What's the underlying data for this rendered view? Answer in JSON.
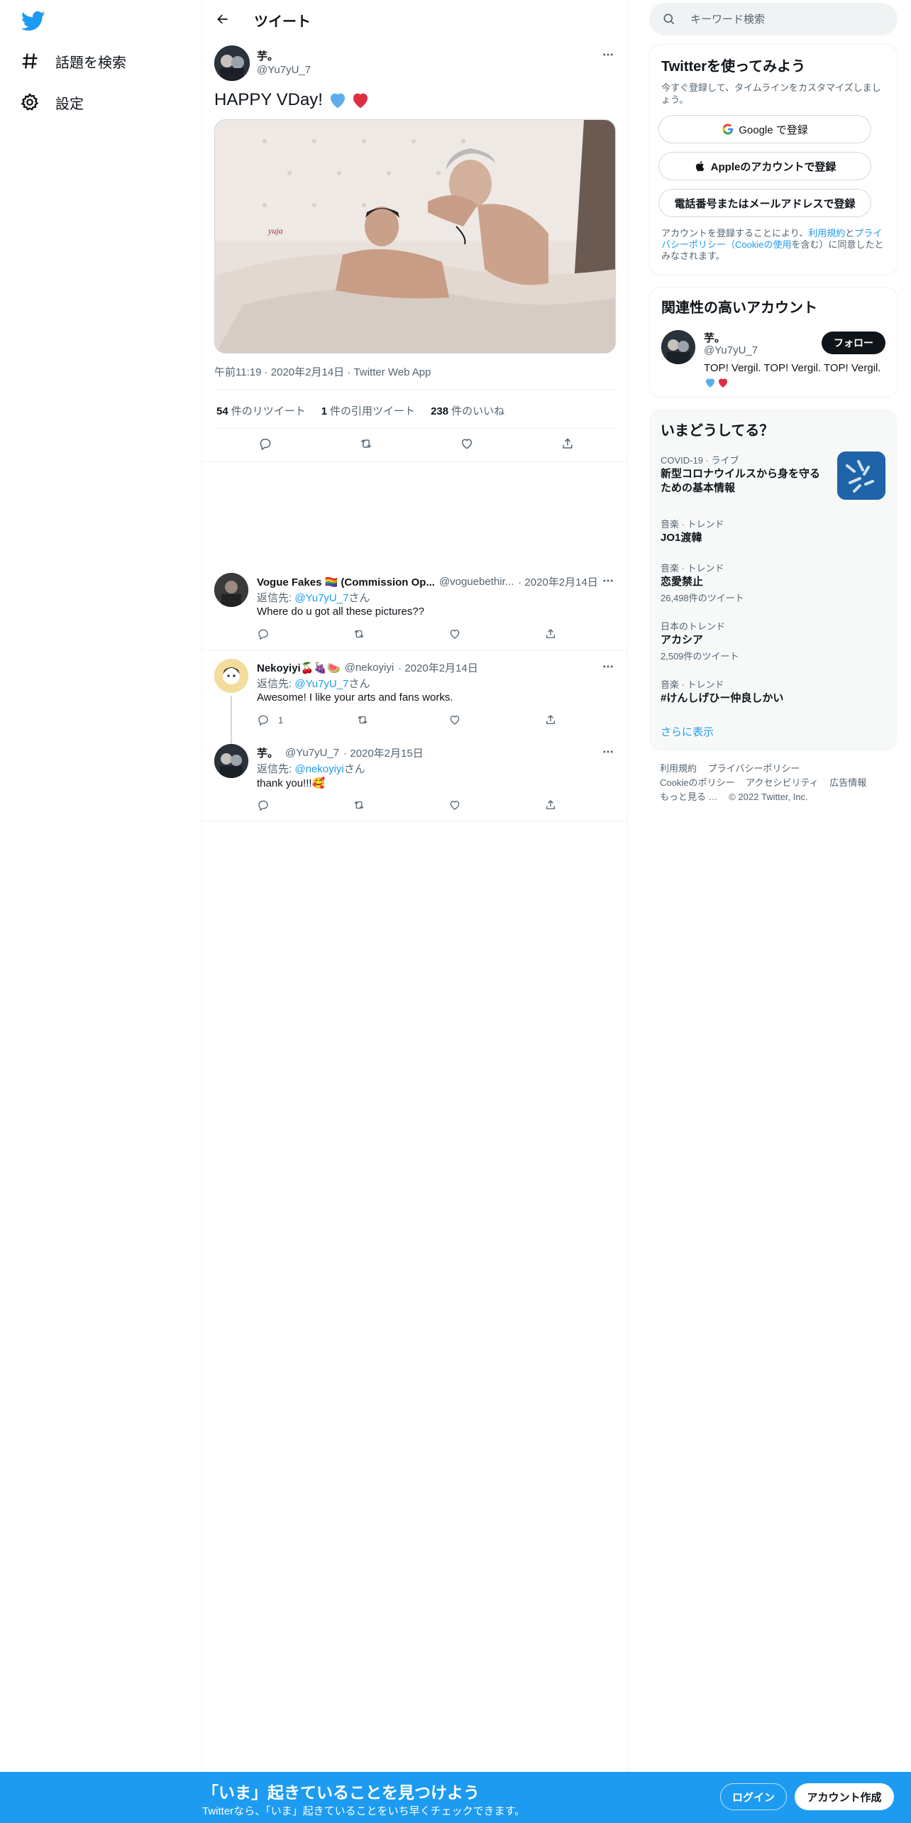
{
  "sidebar": {
    "logo_icon": "twitter-bird-icon",
    "items": [
      {
        "label": "話題を検索",
        "icon": "hashtag-icon"
      },
      {
        "label": "設定",
        "icon": "gear-icon"
      }
    ]
  },
  "header": {
    "title": "ツイート",
    "back_icon": "arrow-left-icon"
  },
  "tweet": {
    "author_name": "芋。",
    "author_handle": "@Yu7yU_7",
    "text": "HAPPY VDay!",
    "emojis": [
      "blue-heart",
      "red-heart"
    ],
    "time": "午前11:19",
    "date": "2020年2月14日",
    "source": "Twitter Web App",
    "dot": "·",
    "stats": {
      "retweets": "54",
      "retweets_label": "件のリツイート",
      "quotes": "1",
      "quotes_label": "件の引用ツイート",
      "likes": "238",
      "likes_label": "件のいいね"
    }
  },
  "replies": [
    {
      "name": "Vogue Fakes 🏳️‍🌈 (Commission Op...",
      "handle": "@voguebethir...",
      "date": "· 2020年2月14日",
      "reply_to_prefix": "返信先: ",
      "reply_to": "@Yu7yU_7",
      "reply_to_suffix": "さん",
      "text": "Where do u got all these pictures??",
      "reply_count": ""
    },
    {
      "name": "Nekoyiyi🍒🍇🍉",
      "handle": "@nekoyiyi",
      "date": "· 2020年2月14日",
      "reply_to_prefix": "返信先: ",
      "reply_to": "@Yu7yU_7",
      "reply_to_suffix": "さん",
      "text": "Awesome! I like your arts and fans works.",
      "reply_count": "1"
    },
    {
      "name": "芋。",
      "handle": "@Yu7yU_7",
      "date": "· 2020年2月15日",
      "reply_to_prefix": "返信先: ",
      "reply_to": "@nekoyiyi",
      "reply_to_suffix": "さん",
      "text": "thank you!!!🥰",
      "reply_count": ""
    }
  ],
  "search": {
    "placeholder": "キーワード検索"
  },
  "signup_card": {
    "title": "Twitterを使ってみよう",
    "subtitle": "今すぐ登録して、タイムラインをカスタマイズしましょう。",
    "google": "Google で登録",
    "apple": "Appleのアカウントで登録",
    "phone": "電話番号またはメールアドレスで登録",
    "legal_1": "アカウントを登録することにより、",
    "legal_terms": "利用規約",
    "legal_2": "と",
    "legal_privacy": "プライバシーポリシー（Cookieの使用",
    "legal_3": "を含む）に同意したとみなされます。"
  },
  "related": {
    "title": "関連性の高いアカウント",
    "name": "芋。",
    "handle": "@Yu7yU_7",
    "bio": "TOP! Vergil. TOP! Vergil. TOP! Vergil.",
    "follow": "フォロー"
  },
  "trends": {
    "title": "いまどうしてる？",
    "items": [
      {
        "context": "COVID-19 · ライブ",
        "title": "新型コロナウイルスから身を守るための基本情報",
        "count": ""
      },
      {
        "context": "音楽 · トレンド",
        "title": "JO1渡韓",
        "count": ""
      },
      {
        "context": "音楽 · トレンド",
        "title": "恋愛禁止",
        "count": "26,498件のツイート"
      },
      {
        "context": "日本のトレンド",
        "title": "アカシア",
        "count": "2,509件のツイート"
      },
      {
        "context": "音楽 · トレンド",
        "title": "#けんしげひー仲良しかい",
        "count": ""
      }
    ],
    "show_more": "さらに表示"
  },
  "footer": {
    "links": [
      "利用規約",
      "プライバシーポリシー",
      "Cookieのポリシー",
      "アクセシビリティ",
      "広告情報",
      "もっと見る …",
      "© 2022 Twitter, Inc."
    ]
  },
  "bottom_bar": {
    "title": "「いま」起きていることを見つけよう",
    "subtitle": "Twitterなら、「いま」起きていることをいち早くチェックできます。",
    "login": "ログイン",
    "signup": "アカウント作成"
  },
  "colors": {
    "accent": "#1d9bf0",
    "text": "#0f1419",
    "muted": "#536471",
    "border": "#eff3f4"
  }
}
